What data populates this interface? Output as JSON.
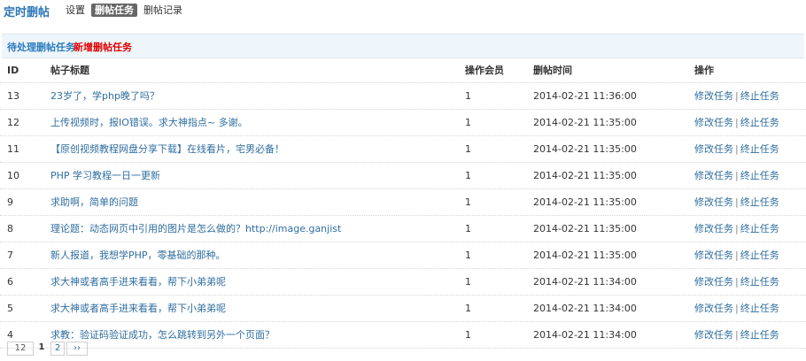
{
  "header": {
    "title": "定时删帖",
    "tabs": [
      {
        "label": "设置"
      },
      {
        "label": "删帖任务"
      },
      {
        "label": "删帖记录"
      }
    ]
  },
  "subnav": {
    "pending_label": "待处理删帖任务",
    "add_label": "新增删帖任务"
  },
  "table": {
    "headers": {
      "id": "ID",
      "title": "帖子标题",
      "member": "操作会员",
      "time": "删帖时间",
      "ops": "操作"
    },
    "edit_label": "修改任务",
    "separator": "|",
    "stop_label": "终止任务",
    "rows": [
      {
        "id": "13",
        "title": "23岁了，学php晚了吗？",
        "member": "1",
        "time": "2014-02-21 11:36:00"
      },
      {
        "id": "12",
        "title": "上传视频时，报IO错误。求大神指点~ 多谢。",
        "member": "1",
        "time": "2014-02-21 11:35:00"
      },
      {
        "id": "11",
        "title": "【原创视频教程网盘分享下载】在线看片，宅男必备！",
        "member": "1",
        "time": "2014-02-21 11:35:00"
      },
      {
        "id": "10",
        "title": "PHP 学习教程一日一更新",
        "member": "1",
        "time": "2014-02-21 11:35:00"
      },
      {
        "id": "9",
        "title": "求助啊，简单的问题",
        "member": "1",
        "time": "2014-02-21 11:35:00"
      },
      {
        "id": "8",
        "title": "理论题：动态网页中引用的图片是怎么做的？http://image.ganjist",
        "member": "1",
        "time": "2014-02-21 11:35:00"
      },
      {
        "id": "7",
        "title": "新人报道，我想学PHP，零基础的那种。",
        "member": "1",
        "time": "2014-02-21 11:35:00"
      },
      {
        "id": "6",
        "title": "求大神或者高手进来看看，帮下小弟弟呢",
        "member": "1",
        "time": "2014-02-21 11:34:00"
      },
      {
        "id": "5",
        "title": "求大神或者高手进来看看，帮下小弟弟呢",
        "member": "1",
        "time": "2014-02-21 11:34:00"
      },
      {
        "id": "4",
        "title": "求教：验证码验证成功，怎么跳转到另外一个页面？",
        "member": "1",
        "time": "2014-02-21 11:34:00"
      }
    ]
  },
  "pagination": {
    "total": "12",
    "current": "1",
    "next_page": "2",
    "next_label": "››"
  }
}
